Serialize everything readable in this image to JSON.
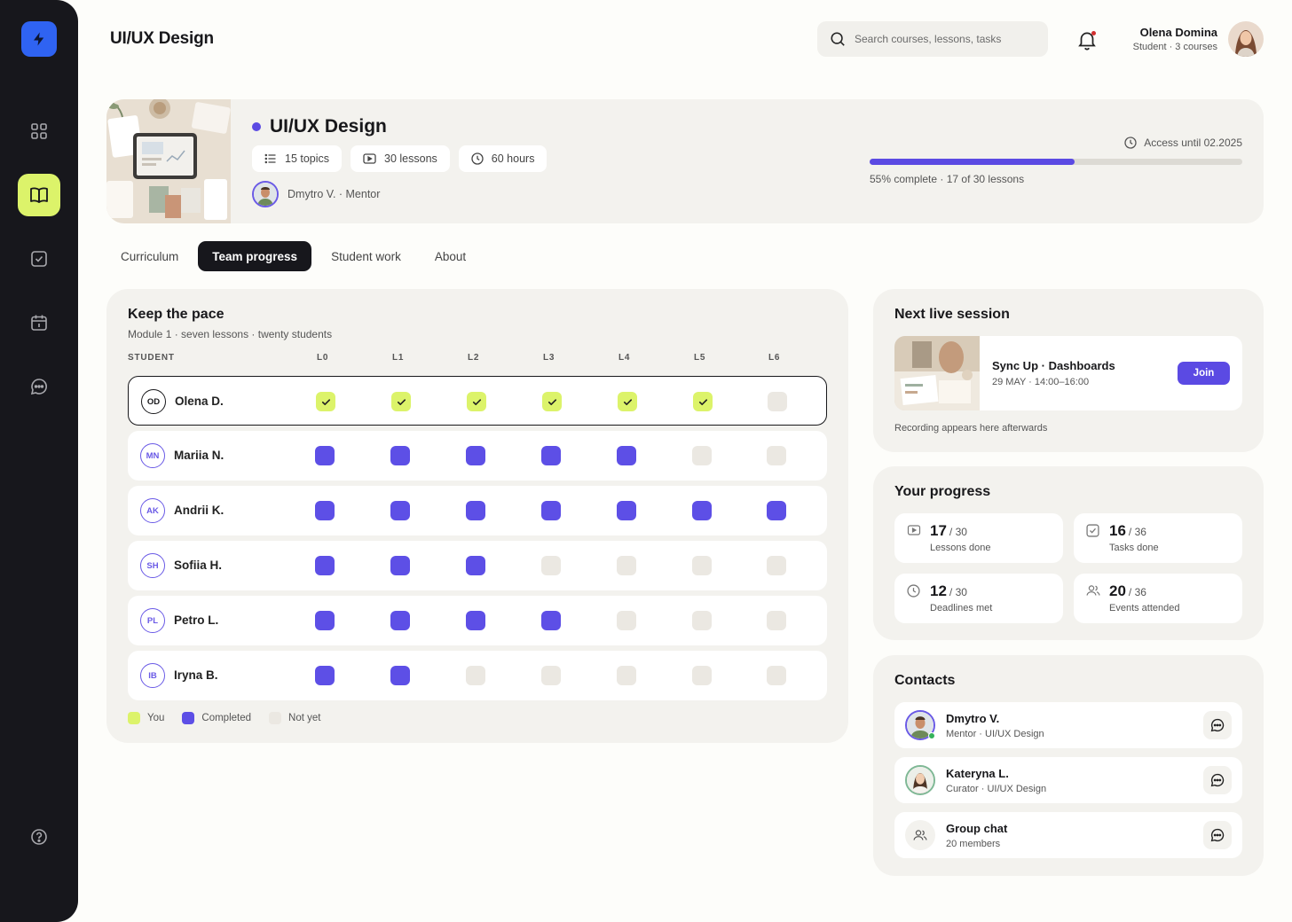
{
  "header": {
    "title": "UI/UX Design",
    "search_placeholder": "Search courses, lessons, tasks",
    "user_name": "Olena Domina",
    "user_sub": "Student · 3 courses"
  },
  "course": {
    "title": "UI/UX Design",
    "topics": "15 topics",
    "lessons": "30 lessons",
    "hours": "60 hours",
    "mentor": "Dmytro V. · Mentor",
    "access": "Access until 02.2025",
    "progress_fraction": 0.55,
    "progress_text": "55% complete · 17 of 30 lessons"
  },
  "tabs": [
    "Curriculum",
    "Team progress",
    "Student work",
    "About"
  ],
  "pace": {
    "title": "Keep the pace",
    "subtitle": "Module 1 · seven lessons · twenty students",
    "student_header": "STUDENT",
    "lessons": [
      "L0",
      "L1",
      "L2",
      "L3",
      "L4",
      "L5",
      "L6"
    ],
    "students": [
      {
        "initials": "OD",
        "name": "Olena D.",
        "me": true,
        "status": [
          "you",
          "you",
          "you",
          "you",
          "you",
          "you",
          "no"
        ]
      },
      {
        "initials": "MN",
        "name": "Mariia N.",
        "status": [
          "done",
          "done",
          "done",
          "done",
          "done",
          "no",
          "no"
        ]
      },
      {
        "initials": "AK",
        "name": "Andrii K.",
        "status": [
          "done",
          "done",
          "done",
          "done",
          "done",
          "done",
          "done"
        ]
      },
      {
        "initials": "SH",
        "name": "Sofiia H.",
        "status": [
          "done",
          "done",
          "done",
          "no",
          "no",
          "no",
          "no"
        ]
      },
      {
        "initials": "PL",
        "name": "Petro L.",
        "status": [
          "done",
          "done",
          "done",
          "done",
          "no",
          "no",
          "no"
        ]
      },
      {
        "initials": "IB",
        "name": "Iryna B.",
        "status": [
          "done",
          "done",
          "no",
          "no",
          "no",
          "no",
          "no"
        ]
      }
    ],
    "legend": {
      "you": "You",
      "done": "Completed",
      "no": "Not yet"
    }
  },
  "session": {
    "title": "Next live session",
    "name": "Sync Up · Dashboards",
    "time": "29 MAY · 14:00–16:00",
    "join": "Join",
    "note": "Recording appears here afterwards"
  },
  "progress": {
    "title": "Your progress",
    "stats": [
      {
        "value": "17",
        "total": "/ 30",
        "label": "Lessons done",
        "icon": "play-icon"
      },
      {
        "value": "16",
        "total": "/ 36",
        "label": "Tasks done",
        "icon": "check-square-icon"
      },
      {
        "value": "12",
        "total": "/ 30",
        "label": "Deadlines met",
        "icon": "clock-icon"
      },
      {
        "value": "20",
        "total": "/ 36",
        "label": "Events attended",
        "icon": "users-icon"
      }
    ]
  },
  "contacts": {
    "title": "Contacts",
    "items": [
      {
        "name": "Dmytro V.",
        "role": "Mentor · UI/UX Design"
      },
      {
        "name": "Kateryna L.",
        "role": "Curator · UI/UX Design"
      },
      {
        "name": "Group chat",
        "role": "20 members"
      }
    ]
  },
  "colors": {
    "accent": "#5b4ae3",
    "lime": "#dcf36a",
    "sidebar": "#17171c",
    "logo": "#2f63f2"
  }
}
